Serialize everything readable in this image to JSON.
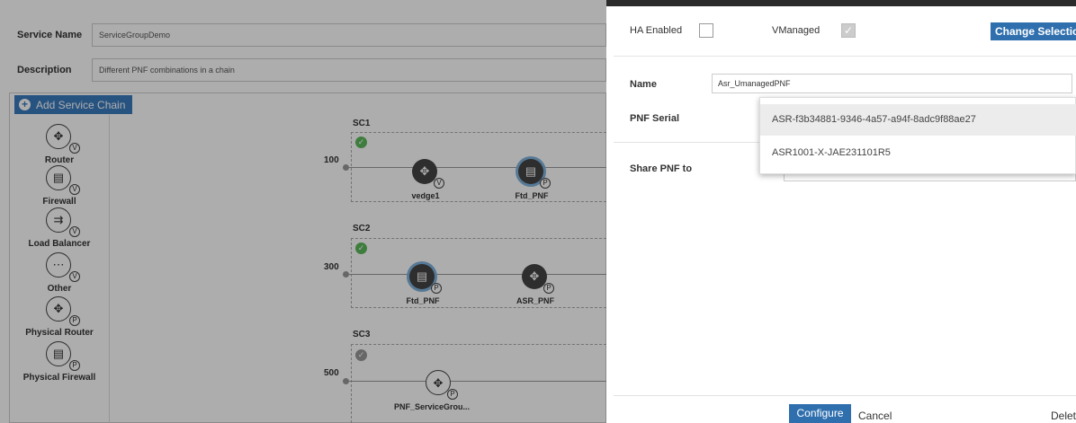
{
  "form": {
    "service_name_label": "Service Name",
    "service_name_value": "ServiceGroupDemo",
    "description_label": "Description",
    "description_value": "Different PNF combinations in a chain"
  },
  "canvas": {
    "add_chain_label": "Add Service Chain",
    "palette": [
      {
        "label": "Router",
        "icon": "router-icon",
        "badge": "V"
      },
      {
        "label": "Firewall",
        "icon": "firewall-icon",
        "badge": "V"
      },
      {
        "label": "Load Balancer",
        "icon": "load-balancer-icon",
        "badge": "V"
      },
      {
        "label": "Other",
        "icon": "other-icon",
        "badge": "V"
      },
      {
        "label": "Physical Router",
        "icon": "router-icon",
        "badge": "P"
      },
      {
        "label": "Physical Firewall",
        "icon": "firewall-icon",
        "badge": "P"
      }
    ],
    "chains": [
      {
        "name": "SC1",
        "bandwidth": "100",
        "status": "valid",
        "nodes": [
          {
            "label": "vedge1",
            "icon": "router-icon",
            "badge": "V"
          },
          {
            "label": "Ftd_PNF",
            "icon": "firewall-icon",
            "badge": "P"
          }
        ]
      },
      {
        "name": "SC2",
        "bandwidth": "300",
        "status": "valid",
        "nodes": [
          {
            "label": "Ftd_PNF",
            "icon": "firewall-icon",
            "badge": "P"
          },
          {
            "label": "ASR_PNF",
            "icon": "router-icon",
            "badge": "P"
          }
        ]
      },
      {
        "name": "SC3",
        "bandwidth": "500",
        "status": "pending",
        "nodes": [
          {
            "label": "PNF_ServiceGrou...",
            "icon": "router-icon",
            "badge": "P"
          }
        ]
      }
    ]
  },
  "panel": {
    "ha_enabled_label": "HA Enabled",
    "ha_enabled_checked": false,
    "vmanaged_label": "VManaged",
    "vmanaged_checked": true,
    "change_selection_label": "Change Selection",
    "name_label": "Name",
    "name_value": "Asr_UmanagedPNF",
    "pnf_serial_label": "PNF Serial",
    "share_pnf_label": "Share PNF to",
    "serial_options": [
      "ASR-f3b34881-9346-4a57-a94f-8adc9f88ae27",
      "ASR1001-X-JAE231101R5"
    ],
    "configure_label": "Configure",
    "cancel_label": "Cancel",
    "delete_label": "Delet"
  },
  "colors": {
    "primary_button": "#2f6fae",
    "valid_status": "#5cb85c"
  }
}
